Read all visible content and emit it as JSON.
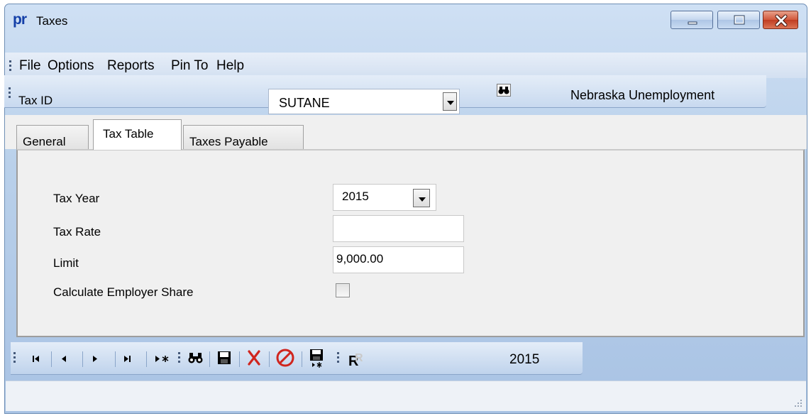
{
  "window": {
    "title": "Taxes",
    "app_logo_text": "pr"
  },
  "menu": {
    "items": [
      "File",
      "Options",
      "Reports",
      "Pin To",
      "Help"
    ]
  },
  "tax_id_bar": {
    "label": "Tax ID",
    "value": "SUTANE",
    "description": "Nebraska Unemployment"
  },
  "tabs": [
    {
      "label": "General",
      "selected": false
    },
    {
      "label": "Tax Table",
      "selected": true
    },
    {
      "label": "Taxes Payable",
      "selected": false
    }
  ],
  "form": {
    "tax_year_label": "Tax Year",
    "tax_year_value": "2015",
    "tax_rate_label": "Tax Rate",
    "tax_rate_value": "",
    "limit_label": "Limit",
    "limit_value": "9,000.00",
    "employer_share_label": "Calculate Employer Share",
    "employer_share_checked": false
  },
  "toolbar": {
    "year_display": "2015",
    "icons": [
      "first-record-icon",
      "previous-record-icon",
      "next-record-icon",
      "last-record-icon",
      "new-record-icon",
      "find-icon",
      "save-icon",
      "delete-icon",
      "cancel-icon",
      "save-new-icon",
      "report-icon"
    ]
  },
  "colors": {
    "title_bar": "#b9d0ea",
    "accent_blue": "#1540a8",
    "delete_red": "#d0251e",
    "close_button": "#c03d22"
  }
}
